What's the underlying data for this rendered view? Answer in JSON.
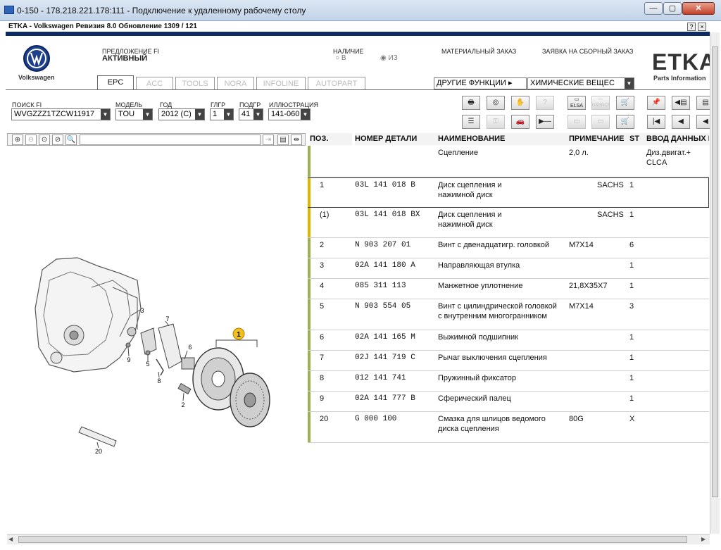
{
  "window": {
    "title": "0-150 - 178.218.221.178:111 - Подключение к удаленному рабочему столу"
  },
  "app": {
    "title": "ETKA - Volkswagen Ревизия 8.0 Обновление 1309 / 121",
    "help": "?",
    "close": "×"
  },
  "brand": {
    "name": "Volkswagen",
    "etka": "ETKA",
    "etka_sub": "Parts Information"
  },
  "header": {
    "proposal_label": "ПРЕДЛОЖЕНИЕ FI",
    "proposal_value": "АКТИВНЫЙ",
    "availability_label": "НАЛИЧИЕ",
    "radio_in": "В",
    "radio_from": "ИЗ",
    "material_order": "МАТЕРИАЛЬНЫЙ ЗАКАЗ",
    "assembly_order": "ЗАЯВКА НА СБОРНЫЙ ЗАКАЗ",
    "other_functions": "ДРУГИЕ ФУНКЦИИ ▸",
    "chemicals": "ХИМИЧЕСКИЕ ВЕЩЕС"
  },
  "tabs": [
    "EPC",
    "ACC",
    "TOOLS",
    "NORA",
    "INFOLINE",
    "AUTOPART"
  ],
  "filters": {
    "search_label": "ПОИСК FI",
    "search_value": "WVGZZZ1TZCW11917",
    "model_label": "МОДЕЛЬ",
    "model_value": "TOU",
    "year_label": "ГОД",
    "year_value": "2012 (C)",
    "group_label": "ГЛГР",
    "group_value": "1",
    "subgroup_label": "ПОДГР",
    "subgroup_value": "41",
    "illus_label": "ИЛЛЮСТРАЦИЯ",
    "illus_value": "141-060"
  },
  "toolbar": {
    "elsa": "ELSA",
    "dsg": "DSGNCF"
  },
  "table": {
    "headers": {
      "pos": "ПОЗ.",
      "part": "НОМЕР ДЕТАЛИ",
      "name": "НАИМЕНОВАНИЕ",
      "note": "ПРИМЕЧАНИЕ",
      "st": "ST",
      "input": "ВВОД ДАННЫХ П"
    },
    "group_row": {
      "name": "Сцепление",
      "note": "2,0 л.",
      "input1": "Диз.двигат.+",
      "input2": "CLCA"
    },
    "rows": [
      {
        "pos": "1",
        "part": "03L  141  018  B",
        "name1": "Диск сцепления и",
        "name2": "нажимной диск",
        "note": "SACHS",
        "st": "1"
      },
      {
        "pos": "(1)",
        "part": "03L  141  018  BX",
        "name1": "Диск сцепления и",
        "name2": "нажимной диск",
        "note": "SACHS",
        "st": "1"
      },
      {
        "pos": "2",
        "part": "N    903  207  01",
        "name1": "Винт с двенадцатигр. головкой",
        "name2": "",
        "note": "M7X14",
        "st": "6"
      },
      {
        "pos": "3",
        "part": "02A  141  180  A",
        "name1": "Направляющая втулка",
        "name2": "",
        "note": "",
        "st": "1"
      },
      {
        "pos": "4",
        "part": "085  311  113",
        "name1": "Манжетное уплотнение",
        "name2": "",
        "note": "21,8X35X7",
        "st": "1"
      },
      {
        "pos": "5",
        "part": "N    903  554  05",
        "name1": "Винт с цилиндрической головкой",
        "name2": "с внутренним многогранником",
        "note": "M7X14",
        "st": "3"
      },
      {
        "pos": "6",
        "part": "02A  141  165  M",
        "name1": "Выжимной подшипник",
        "name2": "",
        "note": "",
        "st": "1"
      },
      {
        "pos": "7",
        "part": "02J  141  719  C",
        "name1": "Рычаг выключения сцепления",
        "name2": "",
        "note": "",
        "st": "1"
      },
      {
        "pos": "8",
        "part": "012  141  741",
        "name1": "Пружинный фиксатор",
        "name2": "",
        "note": "",
        "st": "1"
      },
      {
        "pos": "9",
        "part": "02A  141  777  B",
        "name1": "Сферический палец",
        "name2": "",
        "note": "",
        "st": "1"
      },
      {
        "pos": "20",
        "part": "G    000  100",
        "name1": "Смазка для шлицов ведомого",
        "name2": "диска сцепления",
        "note": "80G",
        "st": "X"
      }
    ]
  },
  "drawing": {
    "callouts": [
      "1",
      "2",
      "3",
      "5",
      "6",
      "7",
      "8",
      "9",
      "20"
    ]
  }
}
